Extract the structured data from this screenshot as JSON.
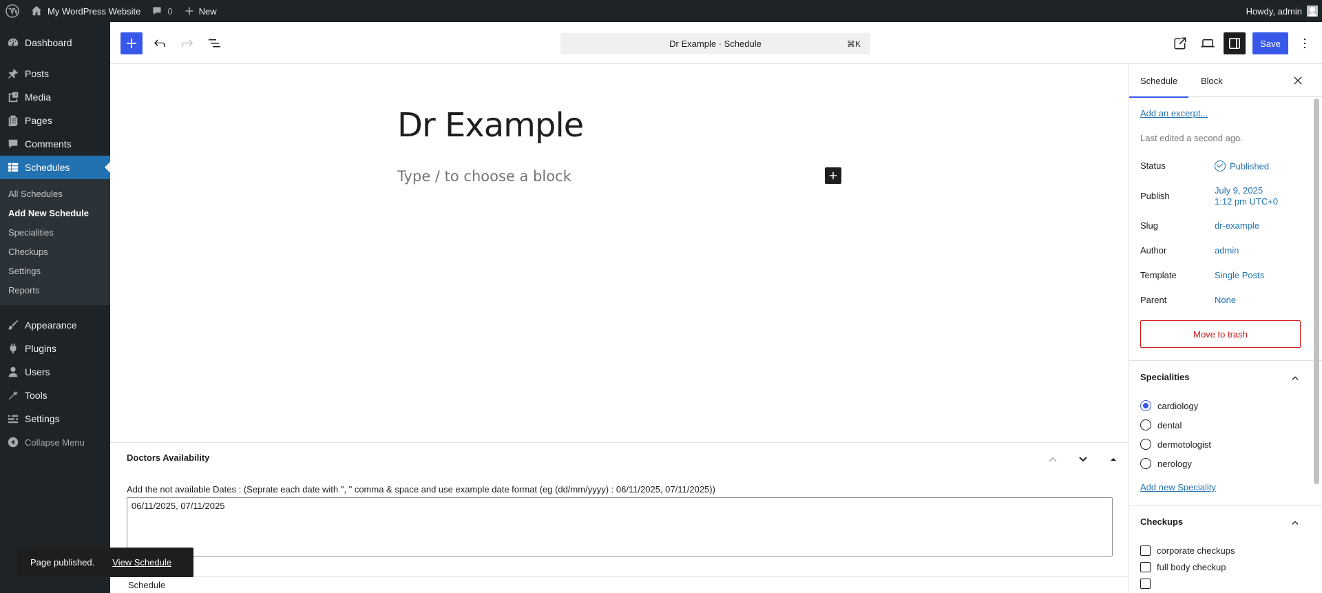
{
  "adminbar": {
    "site_name": "My WordPress Website",
    "comments_count": "0",
    "new_label": "New",
    "greeting": "Howdy, admin"
  },
  "menu": {
    "dashboard": "Dashboard",
    "posts": "Posts",
    "media": "Media",
    "pages": "Pages",
    "comments": "Comments",
    "schedules": "Schedules",
    "submenu": [
      "All Schedules",
      "Add New Schedule",
      "Specialities",
      "Checkups",
      "Settings",
      "Reports"
    ],
    "appearance": "Appearance",
    "plugins": "Plugins",
    "users": "Users",
    "tools": "Tools",
    "settings": "Settings",
    "collapse": "Collapse Menu"
  },
  "header": {
    "command_title": "Dr Example · Schedule",
    "command_shortcut": "⌘K",
    "save_label": "Save"
  },
  "editor": {
    "post_title": "Dr Example",
    "block_placeholder": "Type / to choose a block"
  },
  "metabox": {
    "title": "Doctors Availability",
    "label": "Add the not available Dates : (Seprate each date with \", \" comma & space and use example date format (eg (dd/mm/yyyy) : 06/11/2025, 07/11/2025))",
    "value": "06/11/2025, 07/11/2025"
  },
  "footer": {
    "breadcrumb": "Schedule"
  },
  "snackbar": {
    "message": "Page published.",
    "link": "View Schedule"
  },
  "sidebar": {
    "tab_schedule": "Schedule",
    "tab_block": "Block",
    "excerpt_link": "Add an excerpt...",
    "last_edited": "Last edited a second ago.",
    "rows": {
      "status": {
        "label": "Status",
        "value": "Published"
      },
      "publish": {
        "label": "Publish",
        "value_line1": "July 9, 2025",
        "value_line2": "1:12 pm UTC+0"
      },
      "slug": {
        "label": "Slug",
        "value": "dr-example"
      },
      "author": {
        "label": "Author",
        "value": "admin"
      },
      "template": {
        "label": "Template",
        "value": "Single Posts"
      },
      "parent": {
        "label": "Parent",
        "value": "None"
      }
    },
    "trash_label": "Move to trash",
    "specialities": {
      "title": "Specialities",
      "options": [
        "cardiology",
        "dental",
        "dermotologist",
        "nerology"
      ],
      "selected": "cardiology",
      "add_link": "Add new Speciality"
    },
    "checkups": {
      "title": "Checkups",
      "options": [
        "corporate checkups",
        "full body checkup"
      ]
    }
  },
  "colors": {
    "admin_bg": "#1d2327",
    "accent": "#3858e9",
    "wp_blue": "#2271b1",
    "danger": "#cc1818"
  }
}
